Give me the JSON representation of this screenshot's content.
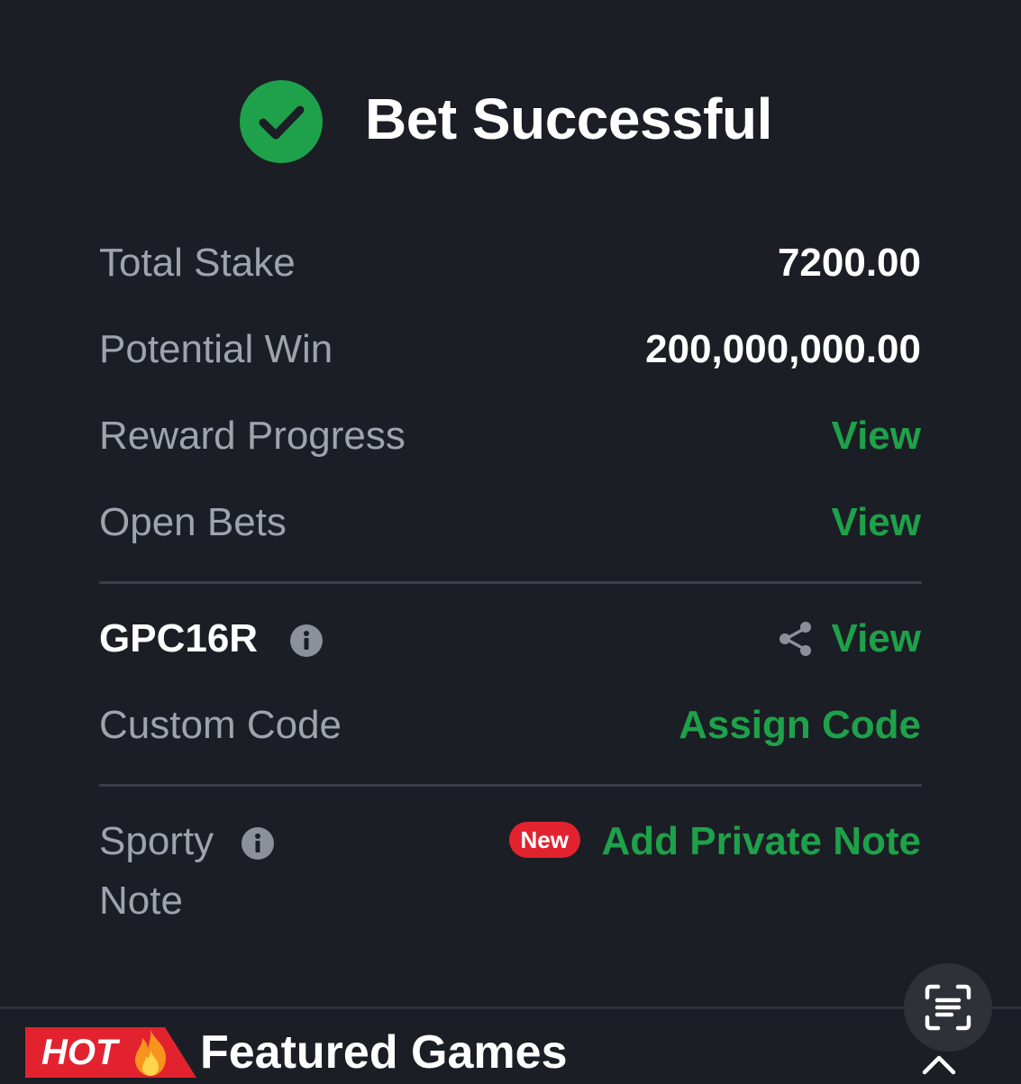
{
  "header": {
    "title": "Bet Successful",
    "icon": "check-circle-icon"
  },
  "summary": {
    "total_stake": {
      "label": "Total Stake",
      "value": "7200.00"
    },
    "potential_win": {
      "label": "Potential Win",
      "value": "200,000,000.00"
    },
    "reward_progress": {
      "label": "Reward Progress",
      "link": "View"
    },
    "open_bets": {
      "label": "Open Bets",
      "link": "View"
    }
  },
  "booking": {
    "code": "GPC16R",
    "view_link": "View",
    "custom_code": {
      "label": "Custom Code",
      "link": "Assign Code"
    }
  },
  "note": {
    "label_line1": "Sporty",
    "label_line2": "Note",
    "badge": "New",
    "link": "Add Private Note"
  },
  "featured": {
    "badge": "HOT",
    "title": "Featured Games"
  },
  "colors": {
    "background": "#1b1e25",
    "accent_green": "#1ea14a",
    "badge_red": "#e2232f",
    "label_grey": "#9ea4ae"
  }
}
